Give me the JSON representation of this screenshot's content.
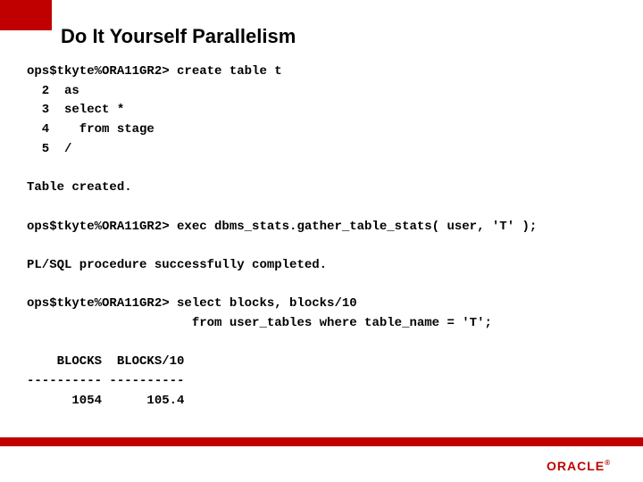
{
  "title": "Do It Yourself Parallelism",
  "code": {
    "l1": "ops$tkyte%ORA11GR2> create table t",
    "l2": "  2  as",
    "l3": "  3  select *",
    "l4": "  4    from stage",
    "l5": "  5  /",
    "l6": "",
    "l7": "Table created.",
    "l8": "",
    "l9": "ops$tkyte%ORA11GR2> exec dbms_stats.gather_table_stats( user, 'T' );",
    "l10": "",
    "l11": "PL/SQL procedure successfully completed.",
    "l12": "",
    "l13": "ops$tkyte%ORA11GR2> select blocks, blocks/10",
    "l14": "                      from user_tables where table_name = 'T';",
    "l15": "",
    "l16": "    BLOCKS  BLOCKS/10",
    "l17": "---------- ----------",
    "l18": "      1054      105.4"
  },
  "logo": "ORACLE",
  "logo_reg": "®"
}
